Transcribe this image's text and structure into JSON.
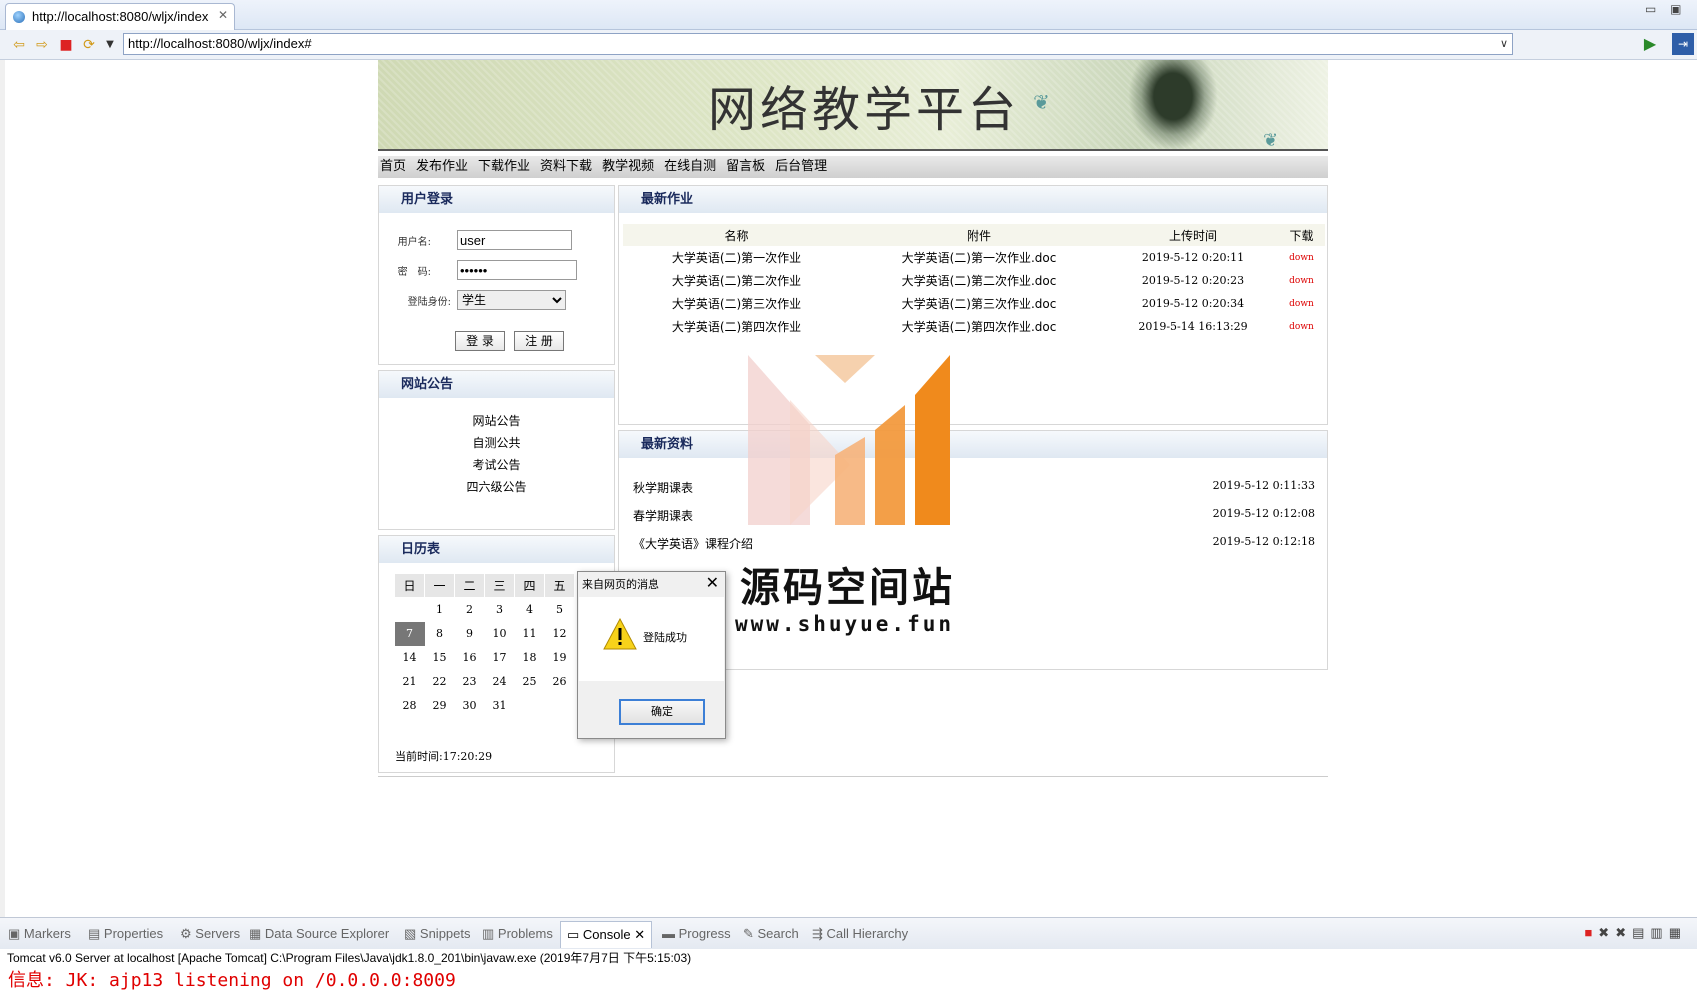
{
  "browser": {
    "tab_title": "http://localhost:8080/wljx/index",
    "url": "http://localhost:8080/wljx/index#"
  },
  "site": {
    "title": "网络教学平台",
    "nav": [
      "首页",
      "发布作业",
      "下载作业",
      "资料下载",
      "教学视频",
      "在线自测",
      "留言板",
      "后台管理"
    ]
  },
  "login": {
    "header": "用户登录",
    "username_label": "用户名:",
    "username_value": "user",
    "password_label": "密　码:",
    "password_value": "••••••",
    "role_label": "登陆身份:",
    "role_value": "学生",
    "login_button": "登 录",
    "register_button": "注 册"
  },
  "notice": {
    "header": "网站公告",
    "items": [
      "网站公告",
      "自测公共",
      "考试公告",
      "四六级公告"
    ]
  },
  "calendar": {
    "header": "日历表",
    "weekdays": [
      "日",
      "一",
      "二",
      "三",
      "四",
      "五"
    ],
    "rows": [
      [
        "",
        "1",
        "2",
        "3",
        "4",
        "5"
      ],
      [
        "7",
        "8",
        "9",
        "10",
        "11",
        "12"
      ],
      [
        "14",
        "15",
        "16",
        "17",
        "18",
        "19"
      ],
      [
        "21",
        "22",
        "23",
        "24",
        "25",
        "26"
      ],
      [
        "28",
        "29",
        "30",
        "31",
        "",
        ""
      ]
    ],
    "today": "7",
    "current_time": "当前时间:17:20:29"
  },
  "homework": {
    "header": "最新作业",
    "columns": [
      "名称",
      "附件",
      "上传时间",
      "下载"
    ],
    "rows": [
      {
        "name": "大学英语(二)第一次作业",
        "file": "大学英语(二)第一次作业.doc",
        "time": "2019-5-12 0:20:11",
        "dl": "down"
      },
      {
        "name": "大学英语(二)第二次作业",
        "file": "大学英语(二)第二次作业.doc",
        "time": "2019-5-12 0:20:23",
        "dl": "down"
      },
      {
        "name": "大学英语(二)第三次作业",
        "file": "大学英语(二)第三次作业.doc",
        "time": "2019-5-12 0:20:34",
        "dl": "down"
      },
      {
        "name": "大学英语(二)第四次作业",
        "file": "大学英语(二)第四次作业.doc",
        "time": "2019-5-14 16:13:29",
        "dl": "down"
      }
    ]
  },
  "resources": {
    "header": "最新资料",
    "rows": [
      {
        "name": "秋学期课表",
        "time": "2019-5-12 0:11:33"
      },
      {
        "name": "春学期课表",
        "time": "2019-5-12 0:12:08"
      },
      {
        "name": "《大学英语》课程介绍",
        "time": "2019-5-12 0:12:18"
      }
    ]
  },
  "watermark": {
    "text": "源码空间站",
    "url": "www.shuyue.fun"
  },
  "dialog": {
    "title": "来自网页的消息",
    "message": "登陆成功",
    "ok": "确定"
  },
  "ide": {
    "tabs": [
      "Markers",
      "Properties",
      "Servers",
      "Data Source Explorer",
      "Snippets",
      "Problems",
      "Console",
      "Progress",
      "Search",
      "Call Hierarchy"
    ],
    "active_tab": "Console",
    "server_line": "Tomcat v6.0 Server at localhost [Apache Tomcat] C:\\Program Files\\Java\\jdk1.8.0_201\\bin\\javaw.exe (2019年7月7日 下午5:15:03)",
    "log_line": "信息: JK: ajp13 listening on /0.0.0.0:8009"
  },
  "colors": {
    "accent_blue": "#3c7fd6",
    "down_red": "#dd0000",
    "log_red": "#e00000"
  }
}
